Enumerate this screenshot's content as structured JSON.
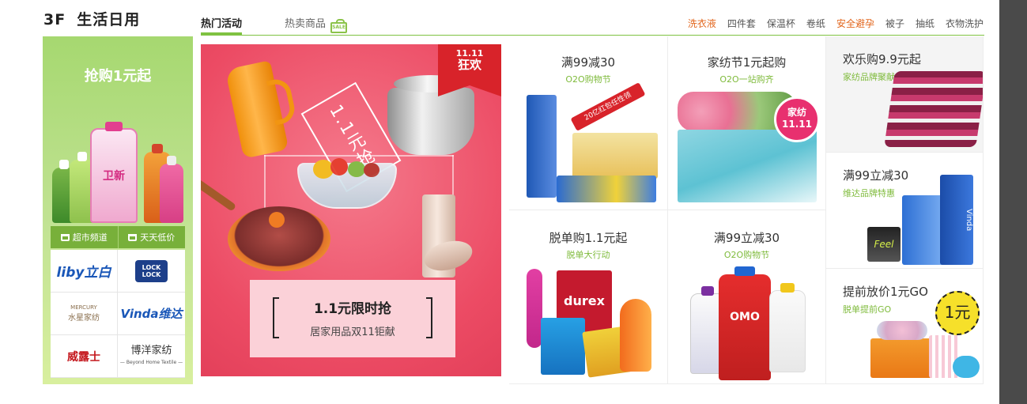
{
  "floor": {
    "number": "3F",
    "name": "生活日用"
  },
  "tabs": {
    "active": "热门活动",
    "normal": "热卖商品",
    "sale_icon_text": "SALE"
  },
  "keywords": [
    {
      "label": "洗衣液",
      "hot": true
    },
    {
      "label": "四件套",
      "hot": false
    },
    {
      "label": "保温杯",
      "hot": false
    },
    {
      "label": "卷纸",
      "hot": false
    },
    {
      "label": "安全避孕",
      "hot": true
    },
    {
      "label": "被子",
      "hot": false
    },
    {
      "label": "抽纸",
      "hot": false
    },
    {
      "label": "衣物洗护",
      "hot": false
    }
  ],
  "left": {
    "title": "抢购1元起",
    "product_label": "卫新",
    "channels": [
      "超市频道",
      "天天低价"
    ],
    "brands": {
      "liby": "liby立白",
      "lock_top": "LOCK",
      "lock_bottom": "LOCK",
      "mercury_en": "MERCURY",
      "mercury_cn": "水星家纺",
      "vinda": "Vinda维达",
      "walch": "威露士",
      "boyang_cn": "博洋家纺",
      "boyang_en": "— Beyond Home Textile —"
    }
  },
  "promo": {
    "ribbon_top": "11.11",
    "ribbon_bottom": "狂欢",
    "tag": "1.1元抢",
    "main": "1.1元限时抢",
    "sub": "居家用品双11钜献"
  },
  "cells": {
    "c1": {
      "title": "满99减30",
      "sub": "O2O购物节",
      "badge": "20亿红包任性领"
    },
    "c2": {
      "title": "家纺节1元起购",
      "sub": "O2O一站购齐",
      "badge_top": "家纺",
      "badge_bottom": "11.11"
    },
    "c3": {
      "title": "欢乐购9.9元起",
      "sub": "家纺品牌聚献"
    },
    "c4": {
      "title": "脱单购1.1元起",
      "sub": "脱单大行动",
      "brand": "durex"
    },
    "c5": {
      "title": "满99立减30",
      "sub": "O2O购物节",
      "brand": "OMO"
    },
    "c6": {
      "title": "满99立减30",
      "sub": "维达品牌特惠",
      "brand": "Vinda"
    },
    "c7": {
      "title": "提前放价1元GO",
      "sub": "脱单提前GO",
      "badge": "1元"
    }
  },
  "colors": {
    "accent_green": "#7fc241",
    "hot_orange": "#e2661d",
    "promo_red": "#ec4b64"
  }
}
